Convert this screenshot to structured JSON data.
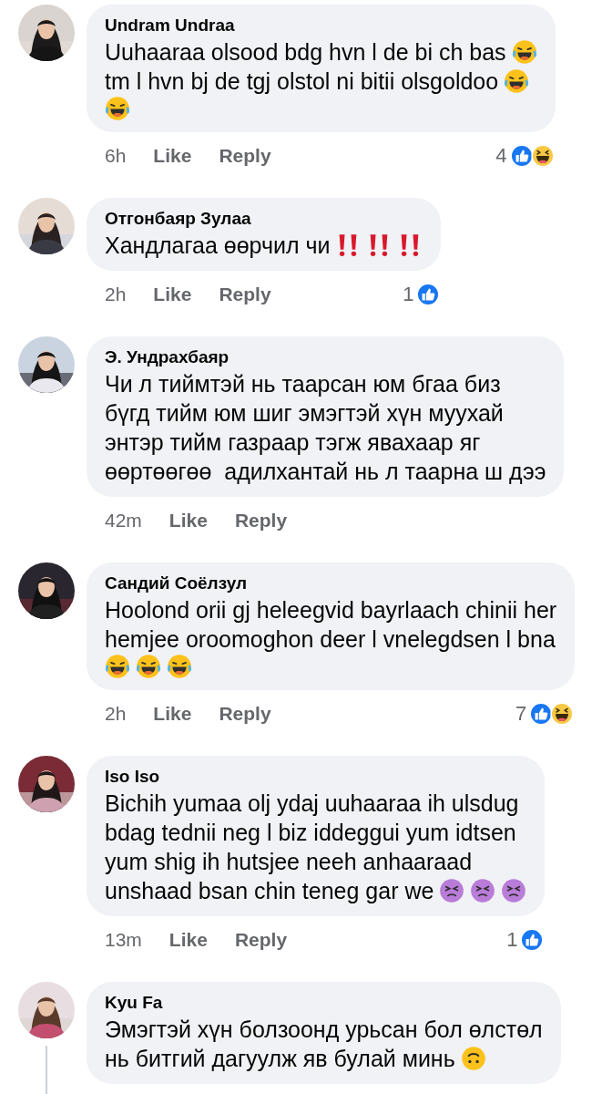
{
  "comments": [
    {
      "author": "Undram Undraa",
      "lines": [
        [
          {
            "kind": "text",
            "text": "Uuhaaraa olsood bdg hvn l de bi ch bas"
          },
          {
            "kind": "joy"
          }
        ],
        [
          {
            "kind": "text",
            "text": "tm l hvn bj de tgj olstol ni bitii olsgoldoo"
          },
          {
            "kind": "joy"
          }
        ],
        [
          {
            "kind": "joy"
          }
        ]
      ],
      "time": "6h",
      "like": "Like",
      "reply": "Reply",
      "reaction_count": "4",
      "reactions": [
        {
          "kind": "like"
        },
        {
          "kind": "haha"
        }
      ]
    },
    {
      "author": "Отгонбаяр Зулаа",
      "lines": [
        [
          {
            "kind": "text",
            "text": "Хандлагаа өөрчил чи"
          },
          {
            "kind": "bangbang"
          },
          {
            "kind": "bangbang"
          },
          {
            "kind": "bangbang"
          }
        ]
      ],
      "time": "2h",
      "like": "Like",
      "reply": "Reply",
      "reaction_count": "1",
      "reactions": [
        {
          "kind": "like"
        }
      ]
    },
    {
      "author": "Э. Ундрахбаяр",
      "lines": [
        [
          {
            "kind": "text",
            "text": "Чи л тиймтэй нь таарсан юм бгаа биз"
          }
        ],
        [
          {
            "kind": "text",
            "text": "бүгд тийм юм шиг эмэгтэй хүн муухай"
          }
        ],
        [
          {
            "kind": "text",
            "text": "энтэр тийм газраар тэгж явахаар яг"
          }
        ],
        [
          {
            "kind": "text",
            "text": "өөртөөгөө  адилхантай нь л таарна ш дээ"
          }
        ]
      ],
      "time": "42m",
      "like": "Like",
      "reply": "Reply"
    },
    {
      "author": "Сандий Соёлзул",
      "lines": [
        [
          {
            "kind": "text",
            "text": "Hoolond orii gj heleegvid bayrlaach chinii her"
          }
        ],
        [
          {
            "kind": "text",
            "text": "hemjee oroomoghon deer l vnelegdsen l bna"
          }
        ],
        [
          {
            "kind": "joy"
          },
          {
            "kind": "joy"
          },
          {
            "kind": "joy"
          }
        ]
      ],
      "time": "2h",
      "like": "Like",
      "reply": "Reply",
      "reaction_count": "7",
      "reactions": [
        {
          "kind": "like"
        },
        {
          "kind": "haha"
        }
      ]
    },
    {
      "author": "Iso Iso",
      "lines": [
        [
          {
            "kind": "text",
            "text": "Bichih yumaa olj ydaj uuhaaraa ih ulsdug"
          }
        ],
        [
          {
            "kind": "text",
            "text": "bdag tednii neg l biz iddeggui yum idtsen"
          }
        ],
        [
          {
            "kind": "text",
            "text": "yum shig ih hutsjee neeh anhaaraad"
          }
        ],
        [
          {
            "kind": "text",
            "text": "unshaad bsan chin teneg gar we"
          },
          {
            "kind": "tired"
          },
          {
            "kind": "tired"
          },
          {
            "kind": "tired"
          }
        ]
      ],
      "time": "13m",
      "like": "Like",
      "reply": "Reply",
      "reaction_count": "1",
      "reactions": [
        {
          "kind": "like"
        }
      ]
    },
    {
      "author": "Kyu Fa",
      "lines": [
        [
          {
            "kind": "text",
            "text": "Эмэгтэй хүн болзоонд урьсан бол өлстөл"
          }
        ],
        [
          {
            "kind": "text",
            "text": "нь битгий дагуулж яв булай минь"
          },
          {
            "kind": "upside"
          }
        ]
      ],
      "thread": true
    }
  ]
}
